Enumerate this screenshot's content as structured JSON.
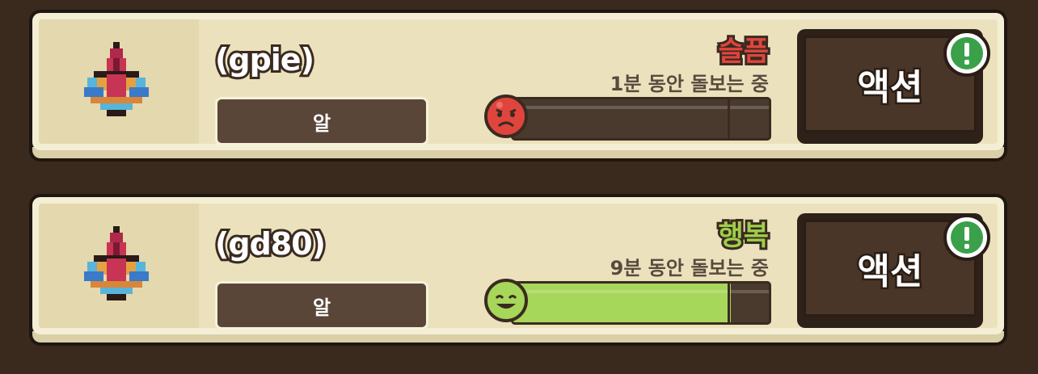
{
  "pets": [
    {
      "name": "(gpie)",
      "stage": "알",
      "mood": "슬픔",
      "mood_color": "#e0453d",
      "duration": "1분 동안 돌보는 중",
      "mood_level": 0.0,
      "bar_color": "#e0453d",
      "face": "sad-face-icon",
      "action_label": "액션",
      "alert_icon": "exclamation-icon"
    },
    {
      "name": "(gd80)",
      "stage": "알",
      "mood": "행복",
      "mood_color": "#9ccf4a",
      "duration": "9분 동안 돌보는 중",
      "mood_level": 0.85,
      "bar_color": "#a6d65a",
      "face": "happy-face-icon",
      "action_label": "액션",
      "alert_icon": "exclamation-icon"
    }
  ]
}
